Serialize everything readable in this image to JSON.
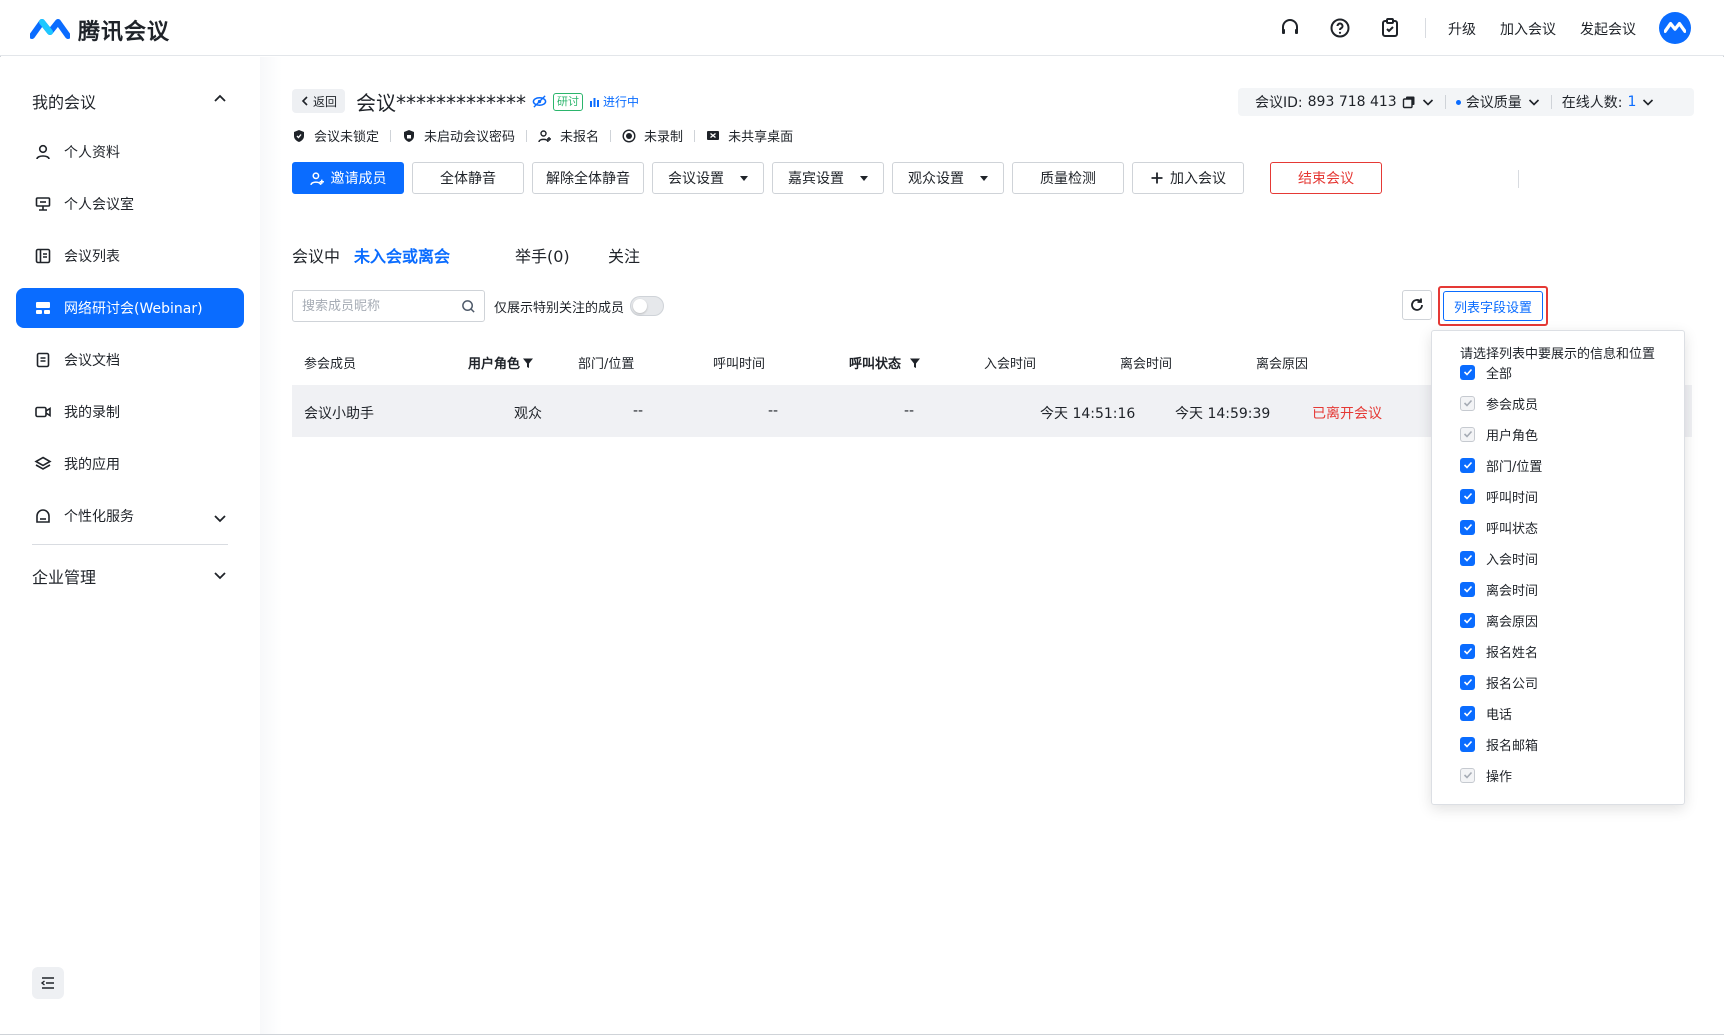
{
  "app": {
    "name": "腾讯会议"
  },
  "topbar": {
    "links": [
      "升级",
      "加入会议",
      "发起会议"
    ]
  },
  "sidebar": {
    "group_my": "我的会议",
    "items": [
      {
        "label": "个人资料",
        "icon": "user-icon"
      },
      {
        "label": "个人会议室",
        "icon": "meeting-room-icon"
      },
      {
        "label": "会议列表",
        "icon": "list-icon"
      },
      {
        "label": "网络研讨会(Webinar)",
        "icon": "webinar-icon",
        "active": true
      },
      {
        "label": "会议文档",
        "icon": "document-icon"
      },
      {
        "label": "我的录制",
        "icon": "video-icon"
      },
      {
        "label": "我的应用",
        "icon": "layers-icon"
      },
      {
        "label": "个性化服务",
        "icon": "service-icon"
      }
    ],
    "group_enterprise": "企业管理"
  },
  "header": {
    "back_label": "返回",
    "title": "会议*************",
    "tag": "研讨",
    "status": "进行中",
    "meeting_id_label": "会议ID:",
    "meeting_id": "893 718 413",
    "quality_label": "会议质量",
    "online_label": "在线人数:",
    "online_count": "1"
  },
  "status_items": [
    "会议未锁定",
    "未启动会议密码",
    "未报名",
    "未录制",
    "未共享桌面"
  ],
  "toolbar": {
    "invite": "邀请成员",
    "mute_all": "全体静音",
    "unmute_all": "解除全体静音",
    "meeting_settings": "会议设置",
    "guest_settings": "嘉宾设置",
    "audience_settings": "观众设置",
    "quality_check": "质量检测",
    "join_meeting": "加入会议",
    "end_meeting": "结束会议"
  },
  "tabs": [
    "会议中",
    "未入会或离会",
    "举手(0)",
    "关注"
  ],
  "filter": {
    "search_placeholder": "搜索成员昵称",
    "toggle_label": "仅展示特别关注的成员",
    "column_settings": "列表字段设置"
  },
  "table": {
    "columns": [
      "参会成员",
      "用户角色",
      "部门/位置",
      "呼叫时间",
      "呼叫状态",
      "入会时间",
      "离会时间",
      "离会原因"
    ],
    "rows": [
      [
        "会议小助手",
        "观众",
        "--",
        "--",
        "--",
        "今天 14:51:16",
        "今天 14:59:39",
        "已离开会议"
      ]
    ]
  },
  "column_panel": {
    "title": "请选择列表中要展示的信息和位置",
    "options": [
      {
        "label": "全部",
        "disabled": false
      },
      {
        "label": "参会成员",
        "disabled": true
      },
      {
        "label": "用户角色",
        "disabled": true
      },
      {
        "label": "部门/位置",
        "disabled": false
      },
      {
        "label": "呼叫时间",
        "disabled": false
      },
      {
        "label": "呼叫状态",
        "disabled": false
      },
      {
        "label": "入会时间",
        "disabled": false
      },
      {
        "label": "离会时间",
        "disabled": false
      },
      {
        "label": "离会原因",
        "disabled": false
      },
      {
        "label": "报名姓名",
        "disabled": false
      },
      {
        "label": "报名公司",
        "disabled": false
      },
      {
        "label": "电话",
        "disabled": false
      },
      {
        "label": "报名邮箱",
        "disabled": false
      },
      {
        "label": "操作",
        "disabled": true
      }
    ]
  },
  "colors": {
    "accent": "#0a6cff",
    "danger": "#e53935",
    "success": "#2bb56c"
  }
}
